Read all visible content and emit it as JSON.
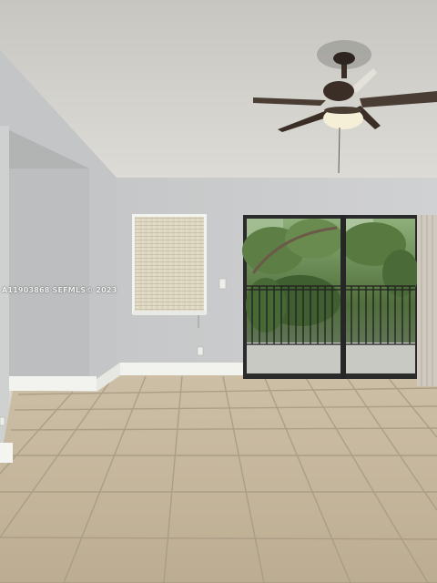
{
  "photo": {
    "watermark": "A11903868 SEFMLS© 2023"
  },
  "palette": {
    "ceiling": "#d2d1cc",
    "wall": "#c9cacb",
    "floor": "#c3b59c",
    "grout": "#a69a84",
    "trim": "#f2f2ee",
    "door_frame": "#2b2b2b",
    "foliage": "#4f6e3a",
    "fan_body": "#3a2e26"
  }
}
